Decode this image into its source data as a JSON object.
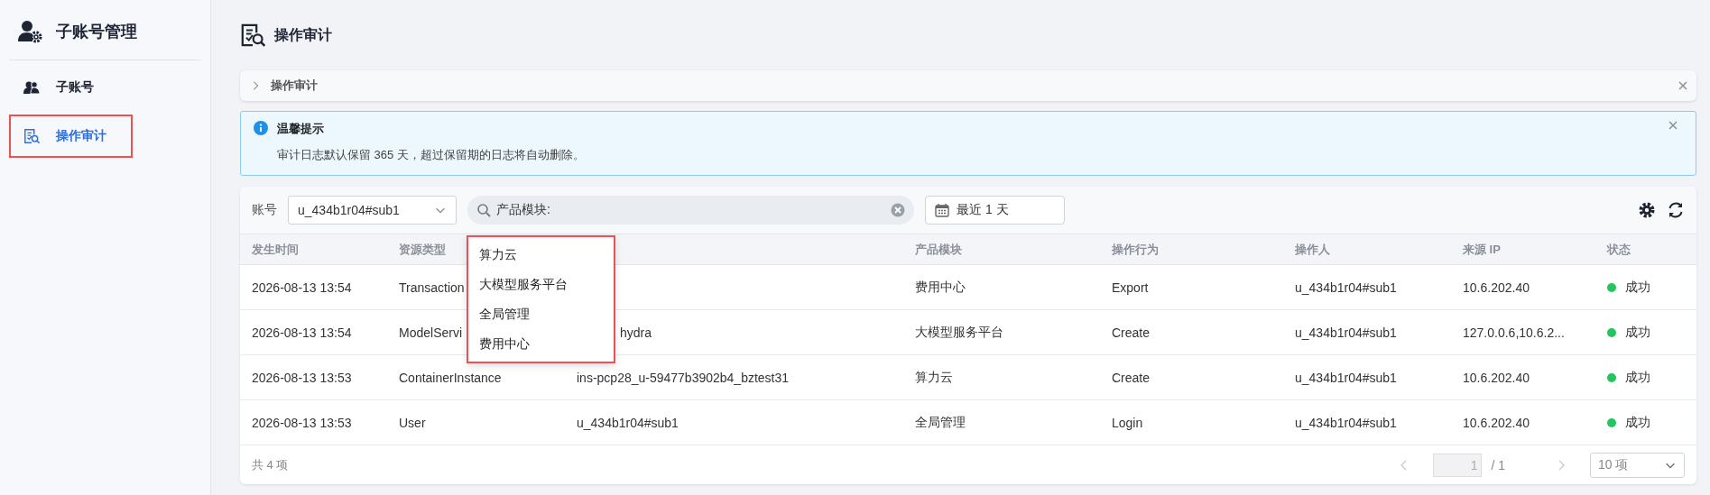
{
  "sidebar": {
    "title": "子账号管理",
    "items": [
      {
        "label": "子账号",
        "selected": false,
        "highlighted": false
      },
      {
        "label": "操作审计",
        "selected": true,
        "highlighted": true
      }
    ]
  },
  "page": {
    "title": "操作审计"
  },
  "breadcrumb": {
    "label": "操作审计"
  },
  "alert": {
    "title": "温馨提示",
    "message": "审计日志默认保留 365 天，超过保留期的日志将自动删除。"
  },
  "toolbar": {
    "account_label": "账号",
    "account": "u_434b1r04#sub1",
    "search": {
      "value": "产品模块:"
    },
    "date_range": "最近 1 天"
  },
  "dropdown": {
    "highlighted": true,
    "options": [
      "算力云",
      "大模型服务平台",
      "全局管理",
      "费用中心"
    ]
  },
  "table": {
    "columns": [
      "发生时间",
      "资源类型",
      "产品模块",
      "操作行为",
      "操作人",
      "来源 IP",
      "状态"
    ],
    "rows": [
      {
        "time": "2026-08-13 13:54",
        "resource_type": "Transaction",
        "product": "费用中心",
        "action": "Export",
        "operator": "u_434b1r04#sub1",
        "source_ip": "10.6.202.40",
        "status": {
          "label": "成功",
          "color": "#22c55e"
        }
      },
      {
        "time": "2026-08-13 13:54",
        "resource_type": "ModelServi",
        "column_3": "hydra",
        "column_3_under_menu": true,
        "product": "大模型服务平台",
        "action": "Create",
        "operator": "u_434b1r04#sub1",
        "source_ip": "127.0.0.6,10.6.2...",
        "status": {
          "label": "成功",
          "color": "#22c55e"
        }
      },
      {
        "time": "2026-08-13 13:53",
        "resource_type": "ContainerInstance",
        "column_3": "ins-pcp28_u-59477b3902b4_bztest31",
        "product": "算力云",
        "action": "Create",
        "operator": "u_434b1r04#sub1",
        "source_ip": "10.6.202.40",
        "status": {
          "label": "成功",
          "color": "#22c55e"
        }
      },
      {
        "time": "2026-08-13 13:53",
        "resource_type": "User",
        "column_3": "u_434b1r04#sub1",
        "product": "全局管理",
        "action": "Login",
        "operator": "u_434b1r04#sub1",
        "source_ip": "10.6.202.40",
        "status": {
          "label": "成功",
          "color": "#22c55e"
        }
      }
    ]
  },
  "footer": {
    "total": "共 4 项",
    "pagination": {
      "prev": {
        "disabled": true
      },
      "page": "1",
      "of": "/ 1",
      "next": {
        "disabled": true
      },
      "page_size": "10 项"
    }
  }
}
